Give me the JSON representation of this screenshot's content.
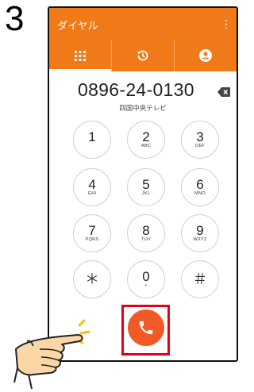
{
  "step_number": "3",
  "app": {
    "title": "ダイヤル",
    "more_icon": "more-vert-icon",
    "accent_color": "#f07a18"
  },
  "tabs": [
    {
      "icon": "dialpad-icon",
      "active": true
    },
    {
      "icon": "history-icon",
      "active": false
    },
    {
      "icon": "contact-icon",
      "active": false
    }
  ],
  "dial": {
    "number": "0896-24-0130",
    "caller_name": "四国中央テレビ"
  },
  "keys": [
    {
      "digit": "1",
      "letters": ""
    },
    {
      "digit": "2",
      "letters": "ABC"
    },
    {
      "digit": "3",
      "letters": "DEF"
    },
    {
      "digit": "4",
      "letters": "GHI"
    },
    {
      "digit": "5",
      "letters": "JKL"
    },
    {
      "digit": "6",
      "letters": "MNO"
    },
    {
      "digit": "7",
      "letters": "PQRS"
    },
    {
      "digit": "8",
      "letters": "TUV"
    },
    {
      "digit": "9",
      "letters": "WXYZ"
    },
    {
      "digit": "＊",
      "letters": ""
    },
    {
      "digit": "0",
      "letters": "+"
    },
    {
      "digit": "＃",
      "letters": ""
    }
  ],
  "call_button": {
    "icon": "phone-icon",
    "color": "#f15a24",
    "highlight_color": "#e50012"
  }
}
